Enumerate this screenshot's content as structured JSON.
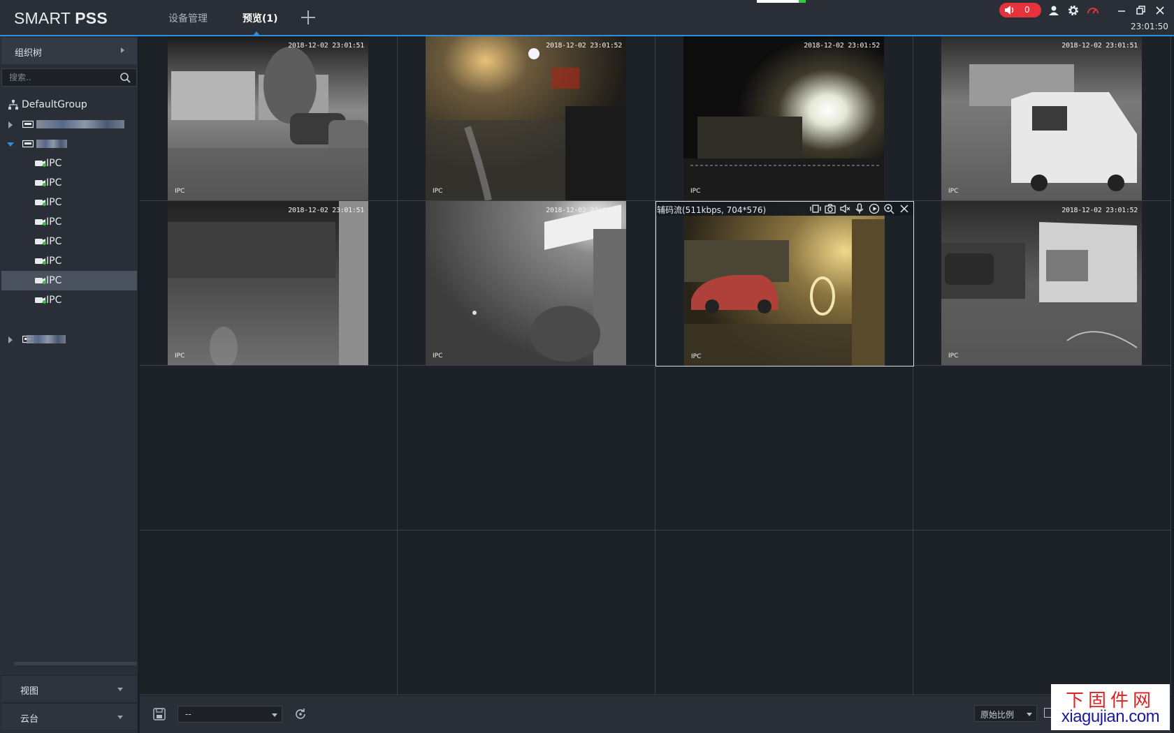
{
  "app": {
    "logo_light": "SMART ",
    "logo_bold": "PSS",
    "tabs": [
      {
        "label": "设备管理"
      },
      {
        "label": "预览(1)"
      }
    ],
    "alarm_count": "0",
    "clock": "23:01:50"
  },
  "sidebar": {
    "header": "组织树",
    "search_placeholder": "搜索..",
    "root_group": "DefaultGroup",
    "channels": [
      "IPC",
      "IPC",
      "IPC",
      "IPC",
      "IPC",
      "IPC",
      "IPC",
      "IPC"
    ],
    "selected_channel_index": 6,
    "bottom": {
      "view": "视图",
      "ptz": "云台"
    }
  },
  "grid": {
    "rows": 4,
    "cols": 4,
    "feeds": [
      {
        "timestamp": "2018-12-02 23:01:51",
        "label": "IPC"
      },
      {
        "timestamp": "2018-12-02 23:01:52",
        "label": "IPC"
      },
      {
        "timestamp": "2018-12-02 23:01:52",
        "label": "IPC"
      },
      {
        "timestamp": "2018-12-02 23:01:51",
        "label": "IPC"
      },
      {
        "timestamp": "2018-12-02 23:01:51",
        "label": "IPC"
      },
      {
        "timestamp": "2018-12-02 23:01:51",
        "label": "IPC"
      },
      {
        "timestamp": "",
        "label": "IPC",
        "stream_info": "辅码流(511kbps, 704*576)"
      },
      {
        "timestamp": "2018-12-02 23:01:52",
        "label": "IPC"
      }
    ]
  },
  "toolbar": {
    "view_select_value": "--",
    "ratio_select_value": "原始比例"
  },
  "watermark": {
    "cn": "下固件网",
    "en": "xiagujian.com"
  },
  "colors": {
    "accent": "#2f8ee0",
    "alarm": "#e6323b",
    "online_green": "#2ecc40",
    "background": "#1b1f25",
    "panel": "#2a2f37"
  }
}
